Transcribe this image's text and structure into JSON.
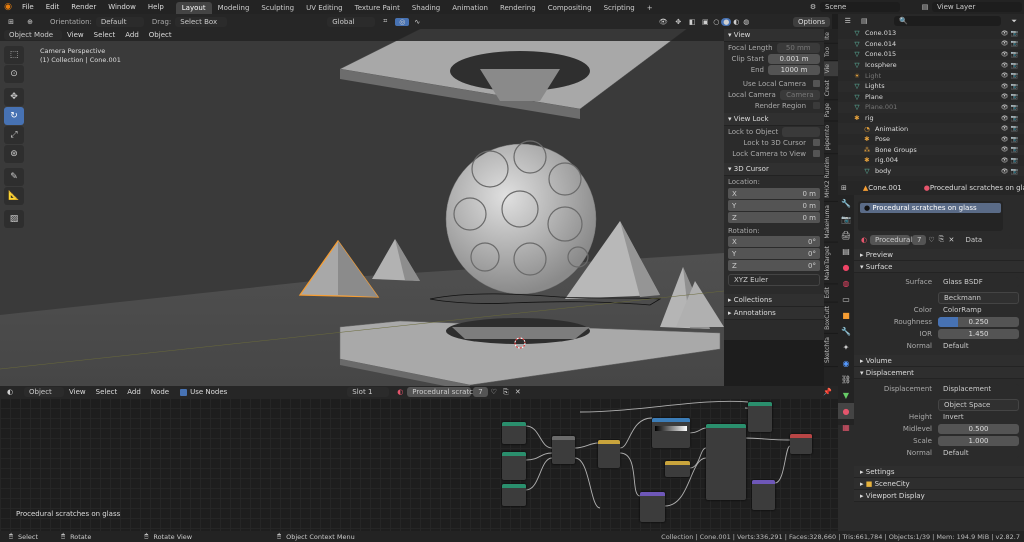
{
  "topbar": {
    "menus": [
      "File",
      "Edit",
      "Render",
      "Window",
      "Help"
    ],
    "workspaces": [
      "Layout",
      "Modeling",
      "Sculpting",
      "UV Editing",
      "Texture Paint",
      "Shading",
      "Animation",
      "Rendering",
      "Compositing",
      "Scripting"
    ],
    "active_workspace": "Layout",
    "add_tab": "+",
    "scene": "Scene",
    "view_layer": "View Layer"
  },
  "viewport_header": {
    "orientation_label": "Orientation:",
    "orientation_value": "Default",
    "drag_label": "Drag:",
    "drag_value": "Select Box",
    "transform_orientation": "Global",
    "options": "Options",
    "mode": "Object Mode",
    "menus": [
      "View",
      "Select",
      "Add",
      "Object"
    ]
  },
  "viewport_info": {
    "line1": "Camera Perspective",
    "line2": "(1) Collection | Cone.001"
  },
  "npanel": {
    "view_section": "View",
    "focal_length_label": "Focal Length",
    "focal_length": "50 mm",
    "clip_start_label": "Clip Start",
    "clip_start": "0.001 m",
    "end_label": "End",
    "end": "1000 m",
    "use_local_camera": "Use Local Camera",
    "local_camera_label": "Local Camera",
    "local_camera_value": "Camera",
    "render_region": "Render Region",
    "view_lock_section": "View Lock",
    "lock_to_object_label": "Lock to Object",
    "lock_to_3d_cursor": "Lock to 3D Cursor",
    "lock_camera_to_view": "Lock Camera to View",
    "cursor_section": "3D Cursor",
    "location_label": "Location:",
    "loc": [
      {
        "axis": "X",
        "value": "0 m"
      },
      {
        "axis": "Y",
        "value": "0 m"
      },
      {
        "axis": "Z",
        "value": "0 m"
      }
    ],
    "rotation_label": "Rotation:",
    "rot": [
      {
        "axis": "X",
        "value": "0°"
      },
      {
        "axis": "Y",
        "value": "0°"
      },
      {
        "axis": "Z",
        "value": "0°"
      }
    ],
    "rotation_mode": "XYZ Euler",
    "collections": "Collections",
    "annotations": "Annotations"
  },
  "ntabs": [
    "Ite",
    "Too",
    "Vie",
    "Creat",
    "Page",
    "pipernto",
    "MHX2 Runtim",
    "MakeHuma",
    "MakeTarget",
    "Edit",
    "BoxCutt",
    "Sketchfa"
  ],
  "outliner": {
    "search_placeholder": "",
    "items": [
      {
        "name": "Cone.013",
        "indent": 0,
        "type": "mesh",
        "muted": false
      },
      {
        "name": "Cone.014",
        "indent": 0,
        "type": "mesh",
        "muted": false
      },
      {
        "name": "Cone.015",
        "indent": 0,
        "type": "mesh",
        "muted": false
      },
      {
        "name": "Icosphere",
        "indent": 0,
        "type": "mesh",
        "muted": false
      },
      {
        "name": "Light",
        "indent": 0,
        "type": "light",
        "muted": true
      },
      {
        "name": "Lights",
        "indent": 0,
        "type": "mesh",
        "muted": false
      },
      {
        "name": "Plane",
        "indent": 0,
        "type": "mesh",
        "muted": false
      },
      {
        "name": "Plane.001",
        "indent": 0,
        "type": "mesh",
        "muted": true
      },
      {
        "name": "rig",
        "indent": 0,
        "type": "armature",
        "muted": false
      },
      {
        "name": "Animation",
        "indent": 1,
        "type": "anim",
        "muted": false
      },
      {
        "name": "Pose",
        "indent": 1,
        "type": "pose",
        "muted": false
      },
      {
        "name": "Bone Groups",
        "indent": 1,
        "type": "bones",
        "muted": false
      },
      {
        "name": "rig.004",
        "indent": 1,
        "type": "armature",
        "muted": false
      },
      {
        "name": "body",
        "indent": 1,
        "type": "mesh",
        "muted": false
      }
    ]
  },
  "properties": {
    "object_name": "Cone.001",
    "material_name": "Procedural scratches on glass",
    "slot_item": "Procedural scratches on glass",
    "material_field": "Procedural",
    "users": "7",
    "data_link": "Data",
    "sections": {
      "preview": "Preview",
      "surface": "Surface",
      "volume": "Volume",
      "displacement": "Displacement",
      "settings": "Settings",
      "scene_city": "SceneCity",
      "viewport_display": "Viewport Display"
    },
    "surface_label": "Surface",
    "surface_value": "Glass BSDF",
    "distribution": "Beckmann",
    "color_label": "Color",
    "color_value": "ColorRamp",
    "roughness_label": "Roughness",
    "roughness_value": "0.250",
    "roughness_fraction": 0.25,
    "ior_label": "IOR",
    "ior_value": "1.450",
    "normal_label": "Normal",
    "normal_value": "Default",
    "displacement_label": "Displacement",
    "displacement_value": "Displacement",
    "space_value": "Object Space",
    "height_label": "Height",
    "height_value": "Invert",
    "midlevel_label": "Midlevel",
    "midlevel_value": "0.500",
    "scale_label": "Scale",
    "scale_value": "1.000",
    "normal2_label": "Normal",
    "normal2_value": "Default"
  },
  "node_header": {
    "mode": "Object",
    "menus": [
      "View",
      "Select",
      "Add",
      "Node"
    ],
    "use_nodes": "Use Nodes",
    "slot": "Slot 1",
    "material": "Procedural scratche...",
    "users": "7"
  },
  "node_editor": {
    "material_label": "Procedural scratches on glass"
  },
  "statusbar": {
    "select": "Select",
    "rotate": "Rotate",
    "rotate_view": "Rotate View",
    "context_menu": "Object Context Menu",
    "stats": "Collection | Cone.001 | Verts:336,291 | Faces:328,660 | Tris:661,784 | Objects:1/39 | Mem: 194.9 MiB | v2.82.7"
  },
  "colors": {
    "accent": "#4772b3",
    "selection": "#f59d33",
    "mesh_icon": "#67d1b7",
    "armature_icon": "#e8a33c"
  }
}
